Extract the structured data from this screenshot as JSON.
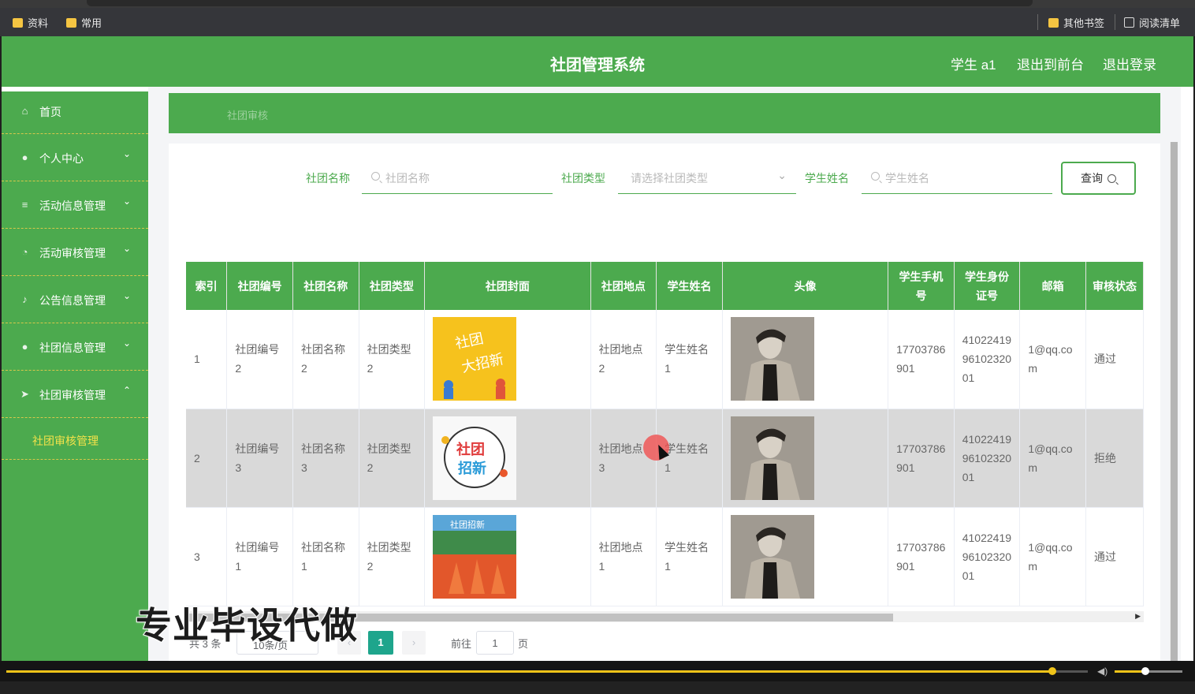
{
  "bookmarks": {
    "items": [
      "资料",
      "常用"
    ],
    "right": [
      "其他书签",
      "阅读清单"
    ]
  },
  "header": {
    "title": "社团管理系统",
    "user": "学生 a1",
    "exit_front": "退出到前台",
    "logout": "退出登录"
  },
  "sidebar": {
    "items": [
      {
        "label": "首页",
        "icon": "home-icon"
      },
      {
        "label": "个人中心",
        "icon": "user-icon"
      },
      {
        "label": "活动信息管理",
        "icon": "list-icon"
      },
      {
        "label": "活动审核管理",
        "icon": "clock-icon"
      },
      {
        "label": "公告信息管理",
        "icon": "bell-icon"
      },
      {
        "label": "社团信息管理",
        "icon": "location-icon"
      },
      {
        "label": "社团审核管理",
        "icon": "send-icon"
      }
    ],
    "sub_item": "社团审核管理"
  },
  "breadcrumb": "社团审核",
  "filters": {
    "club_name_label": "社团名称",
    "club_name_placeholder": "社团名称",
    "club_type_label": "社团类型",
    "club_type_placeholder": "请选择社团类型",
    "student_name_label": "学生姓名",
    "student_name_placeholder": "学生姓名",
    "query_button": "查询"
  },
  "table": {
    "headers": [
      "索引",
      "社团编号",
      "社团名称",
      "社团类型",
      "社团封面",
      "社团地点",
      "学生姓名",
      "头像",
      "学生手机号",
      "学生身份证号",
      "邮箱",
      "审核状态"
    ],
    "rows": [
      {
        "index": "1",
        "club_no": "社团编号2",
        "club_name": "社团名称2",
        "club_type": "社团类型2",
        "location": "社团地点2",
        "student": "学生姓名1",
        "phone": "17703786901",
        "id_card": "410224199610232001",
        "email": "1@qq.com",
        "status": "通过"
      },
      {
        "index": "2",
        "club_no": "社团编号3",
        "club_name": "社团名称3",
        "club_type": "社团类型2",
        "location": "社团地点3",
        "student": "学生姓名1",
        "phone": "17703786901",
        "id_card": "410224199610232001",
        "email": "1@qq.com",
        "status": "拒绝"
      },
      {
        "index": "3",
        "club_no": "社团编号1",
        "club_name": "社团名称1",
        "club_type": "社团类型2",
        "location": "社团地点1",
        "student": "学生姓名1",
        "phone": "17703786901",
        "id_card": "410224199610232001",
        "email": "1@qq.com",
        "status": "通过"
      }
    ]
  },
  "pagination": {
    "total": "共 3 条",
    "page_size": "10条/页",
    "current": "1",
    "goto_label": "前往",
    "goto_value": "1",
    "page_unit": "页"
  },
  "watermark": "专业毕设代做",
  "colors": {
    "primary": "#4caa4e",
    "accent_yellow": "#f3e24a",
    "pager_active": "#1ea58c"
  }
}
